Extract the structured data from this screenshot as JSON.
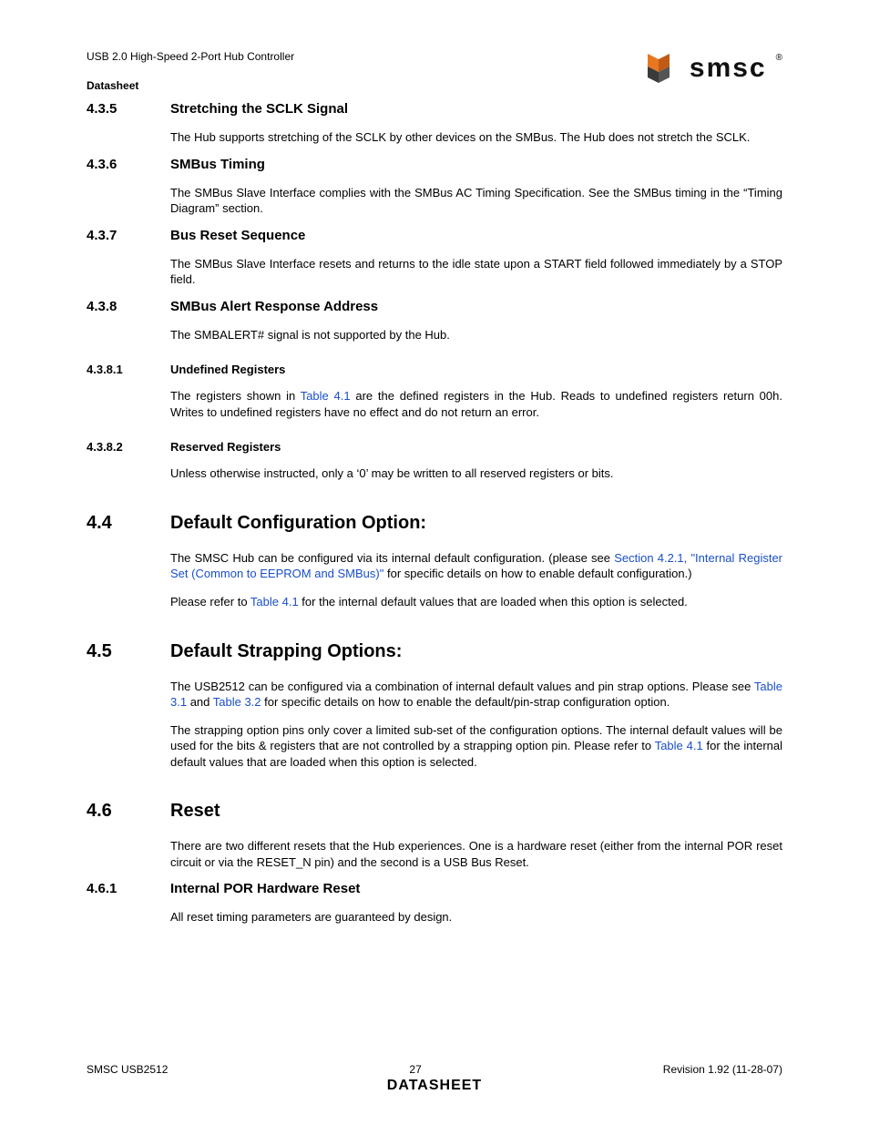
{
  "header": {
    "top": "USB 2.0 High-Speed 2-Port Hub Controller",
    "sub": "Datasheet",
    "logo": "smsc",
    "reg": "®"
  },
  "sections": {
    "s435": {
      "num": "4.3.5",
      "title": "Stretching the SCLK Signal",
      "p1": "The Hub supports stretching of the SCLK by other devices on the SMBus. The Hub does not stretch the SCLK."
    },
    "s436": {
      "num": "4.3.6",
      "title": "SMBus Timing",
      "p1": "The SMBus Slave Interface complies with the SMBus AC Timing Specification. See the SMBus timing in the “Timing Diagram” section."
    },
    "s437": {
      "num": "4.3.7",
      "title": "Bus Reset Sequence",
      "p1": "The SMBus Slave Interface resets and returns to the idle state upon a START field followed immediately by a STOP field."
    },
    "s438": {
      "num": "4.3.8",
      "title": "SMBus Alert Response Address",
      "p1": "The SMBALERT# signal is not supported by the Hub."
    },
    "s4381": {
      "num": "4.3.8.1",
      "title": "Undefined Registers",
      "p1a": "The registers shown in ",
      "p1link": "Table 4.1",
      "p1b": " are the defined registers in the Hub. Reads to undefined registers return 00h. Writes to undefined registers have no effect and do not return an error."
    },
    "s4382": {
      "num": "4.3.8.2",
      "title": "Reserved Registers",
      "p1": "Unless otherwise instructed, only a ‘0’ may be written to all reserved registers or bits."
    },
    "s44": {
      "num": "4.4",
      "title": "Default Configuration Option:",
      "p1a": "The SMSC Hub can be configured via its internal default configuration. (please see ",
      "p1link": "Section 4.2.1, \"Internal Register Set (Common to EEPROM and SMBus)\"",
      "p1b": " for specific details on how to enable default configuration.)",
      "p2a": "Please refer to ",
      "p2link": "Table 4.1",
      "p2b": " for the internal default values that are loaded when this option is selected."
    },
    "s45": {
      "num": "4.5",
      "title": "Default Strapping Options:",
      "p1a": "The USB2512 can be configured via a combination of internal default values and pin strap options. Please see ",
      "p1link1": "Table 3.1",
      "p1mid": " and ",
      "p1link2": "Table 3.2",
      "p1b": " for specific details on how to enable the default/pin-strap configuration option.",
      "p2a": "The strapping option pins only cover a limited sub-set of the configuration options. The internal default values will be used for the bits & registers that are not controlled by a strapping option pin. Please refer to ",
      "p2link": "Table 4.1",
      "p2b": " for the internal default values that are loaded when this option is selected."
    },
    "s46": {
      "num": "4.6",
      "title": "Reset",
      "p1": "There are two different resets that the Hub experiences. One is a hardware reset (either from the internal POR reset circuit or via the RESET_N pin) and the second is a USB Bus Reset."
    },
    "s461": {
      "num": "4.6.1",
      "title": "Internal POR Hardware Reset",
      "p1": "All reset timing parameters are guaranteed by design."
    }
  },
  "footer": {
    "left": "SMSC USB2512",
    "center": "27",
    "right": "Revision 1.92 (11-28-07)",
    "title": "DATASHEET"
  }
}
